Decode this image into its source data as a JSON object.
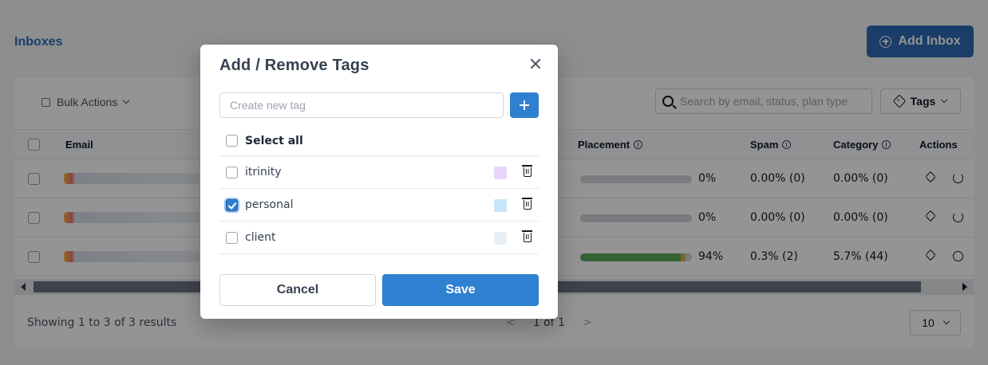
{
  "page": {
    "title": "Inboxes",
    "add_inbox_label": "Add Inbox"
  },
  "toolbar": {
    "bulk_actions_label": "Bulk Actions",
    "search_placeholder": "Search by email, status, plan type",
    "tags_label": "Tags"
  },
  "table": {
    "columns": {
      "email": "Email",
      "placement": "Placement",
      "spam": "Spam",
      "category": "Category",
      "actions": "Actions"
    },
    "rows": [
      {
        "placement_pct": 0,
        "placement_text": "0%",
        "spam": "0.00% (0)",
        "category": "0.00% (0)",
        "action_icon": "refresh-icon"
      },
      {
        "placement_pct": 0,
        "placement_text": "0%",
        "spam": "0.00% (0)",
        "category": "0.00% (0)",
        "action_icon": "refresh-icon"
      },
      {
        "placement_pct": 94,
        "placement_text": "94%",
        "spam": "0.3% (2)",
        "category": "5.7% (44)",
        "action_icon": "pause-icon"
      }
    ]
  },
  "footer": {
    "results_text": "Showing 1 to 3 of 3 results",
    "page_indicator": "1 of 1",
    "prev_label": "<",
    "next_label": ">",
    "per_page": "10"
  },
  "modal": {
    "title": "Add / Remove Tags",
    "new_tag_placeholder": "Create new tag",
    "new_tag_value": "",
    "select_all_label": "Select all",
    "tags": [
      {
        "name": "itrinity",
        "color": "#e9d5fb",
        "checked": false
      },
      {
        "name": "personal",
        "color": "#c6e5f7",
        "checked": true
      },
      {
        "name": "client",
        "color": "#e8f0f5",
        "checked": false
      }
    ],
    "cancel_label": "Cancel",
    "save_label": "Save"
  },
  "colors": {
    "primary": "#2f80d1",
    "header_button": "#2d6cb5",
    "placement_bar_fill": "#57a85a"
  }
}
